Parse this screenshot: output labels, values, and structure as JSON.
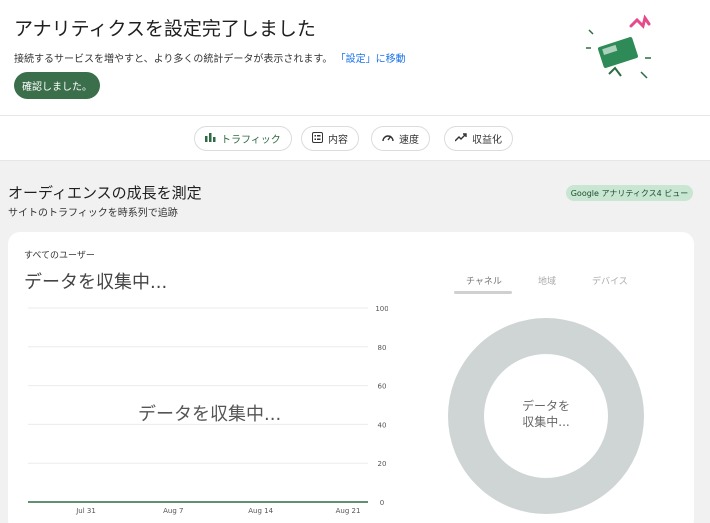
{
  "banner": {
    "title": "アナリティクスを設定完了しました",
    "description": "接続するサービスを増やすと、より多くの統計データが表示されます。",
    "link_text": "「設定」に移動",
    "ack_button": "確認しました。"
  },
  "tabs": [
    {
      "label": "トラフィック",
      "icon": "bar-chart-icon",
      "active": true
    },
    {
      "label": "内容",
      "icon": "content-list-icon",
      "active": false
    },
    {
      "label": "速度",
      "icon": "speedometer-icon",
      "active": false
    },
    {
      "label": "収益化",
      "icon": "trending-up-icon",
      "active": false
    }
  ],
  "section": {
    "title": "オーディエンスの成長を測定",
    "subtitle": "サイトのトラフィックを時系列で追跡",
    "badge": "Google アナリティクス4 ビュー"
  },
  "card": {
    "label": "すべてのユーザー",
    "headline": "データを収集中...",
    "chart_overlay": "データを収集中...",
    "dimension_tabs": [
      "チャネル",
      "地域",
      "デバイス"
    ],
    "donut_text_line1": "データを",
    "donut_text_line2": "収集中..."
  },
  "colors": {
    "accent": "#3b6e4b",
    "line": "#2e6b43",
    "donut": "#cfd4d4"
  },
  "chart_data": [
    {
      "type": "line",
      "x": [
        "Jul 31",
        "Aug 7",
        "Aug 14",
        "Aug 21"
      ],
      "series": [
        {
          "values": [
            0,
            0,
            0,
            0
          ]
        }
      ],
      "y_ticks": [
        0,
        20,
        40,
        60,
        80,
        100
      ],
      "ylim": [
        0,
        100
      ],
      "grid": true,
      "y_axis_side": "right"
    },
    {
      "type": "pie",
      "values": [],
      "style": "donut"
    }
  ]
}
